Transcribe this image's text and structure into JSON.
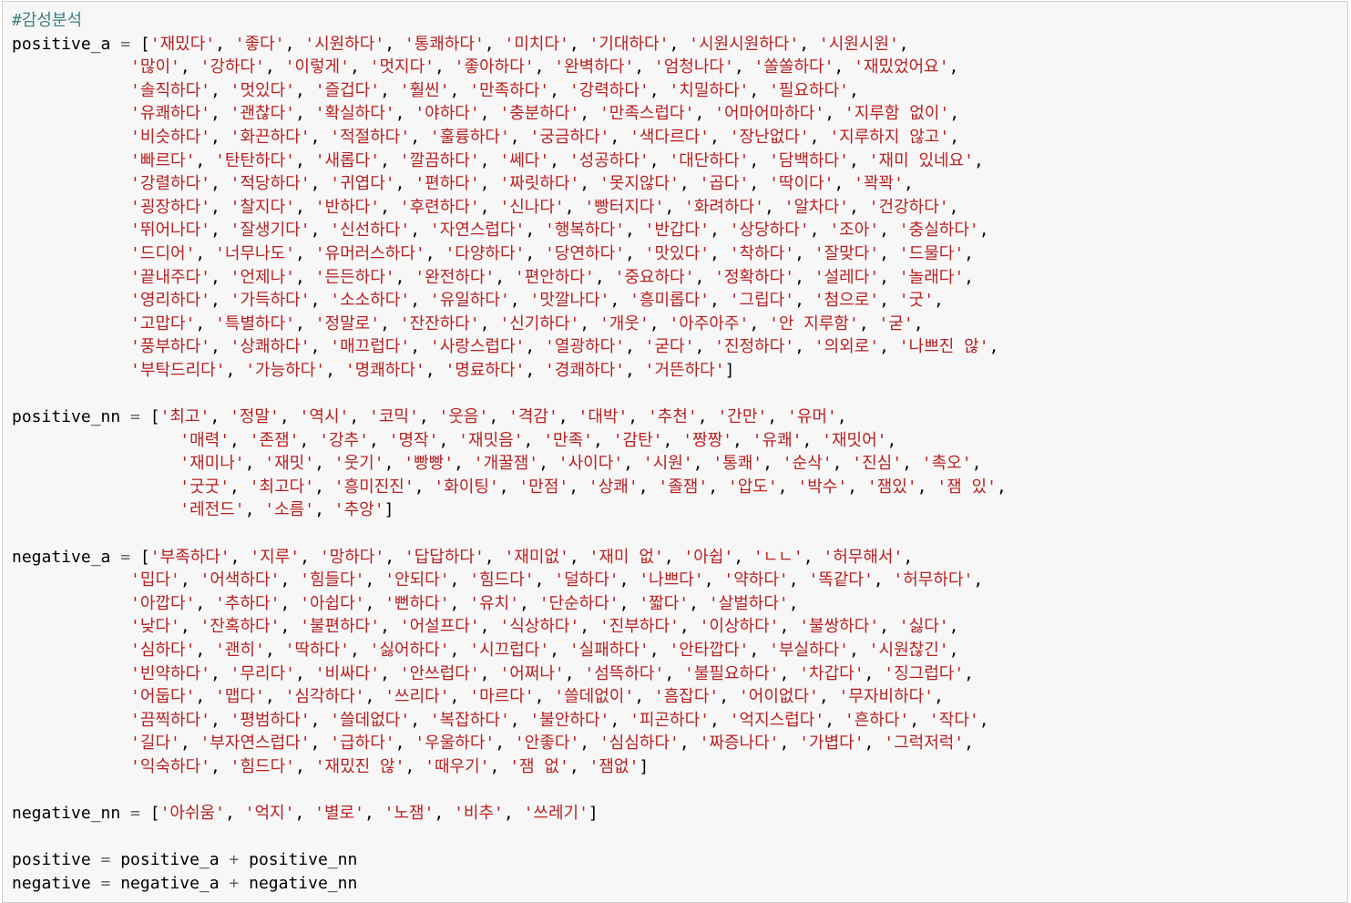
{
  "comment": "#감성분석",
  "blocks": [
    {
      "name": "positive_a",
      "indent": 12,
      "rows": [
        [
          "재밌다",
          "좋다",
          "시원하다",
          "통쾌하다",
          "미치다",
          "기대하다",
          "시원시원하다",
          "시원시원"
        ],
        [
          "많이",
          "강하다",
          "이렇게",
          "멋지다",
          "좋아하다",
          "완벽하다",
          "엄청나다",
          "쏠쏠하다",
          "재밌었어요"
        ],
        [
          "솔직하다",
          "멋있다",
          "즐겁다",
          "훨씬",
          "만족하다",
          "강력하다",
          "치밀하다",
          "필요하다"
        ],
        [
          "유쾌하다",
          "괜찮다",
          "확실하다",
          "야하다",
          "충분하다",
          "만족스럽다",
          "어마어마하다",
          "지루함 없이"
        ],
        [
          "비슷하다",
          "화끈하다",
          "적절하다",
          "훌륭하다",
          "궁금하다",
          "색다르다",
          "장난없다",
          "지루하지 않고"
        ],
        [
          "빠르다",
          "탄탄하다",
          "새롭다",
          "깔끔하다",
          "쎄다",
          "성공하다",
          "대단하다",
          "담백하다",
          "재미 있네요"
        ],
        [
          "강렬하다",
          "적당하다",
          "귀엽다",
          "편하다",
          "짜릿하다",
          "못지않다",
          "곱다",
          "딱이다",
          "꽉꽉"
        ],
        [
          "굉장하다",
          "찰지다",
          "반하다",
          "후련하다",
          "신나다",
          "빵터지다",
          "화려하다",
          "알차다",
          "건강하다"
        ],
        [
          "뛰어나다",
          "잘생기다",
          "신선하다",
          "자연스럽다",
          "행복하다",
          "반갑다",
          "상당하다",
          "조아",
          "충실하다"
        ],
        [
          "드디어",
          "너무나도",
          "유머러스하다",
          "다양하다",
          "당연하다",
          "맛있다",
          "착하다",
          "잘맞다",
          "드물다"
        ],
        [
          "끝내주다",
          "언제나",
          "든든하다",
          "완전하다",
          "편안하다",
          "중요하다",
          "정확하다",
          "설레다",
          "놀래다"
        ],
        [
          "영리하다",
          "가득하다",
          "소소하다",
          "유일하다",
          "맛깔나다",
          "흥미롭다",
          "그립다",
          "첨으로",
          "굿"
        ],
        [
          "고맙다",
          "특별하다",
          "정말로",
          "잔잔하다",
          "신기하다",
          "개웃",
          "아주아주",
          "안 지루함",
          "굳"
        ],
        [
          "풍부하다",
          "상쾌하다",
          "매끄럽다",
          "사랑스럽다",
          "열광하다",
          "굳다",
          "진정하다",
          "의외로",
          "나쁘진 않"
        ],
        [
          "부탁드리다",
          "가능하다",
          "명쾌하다",
          "명료하다",
          "경쾌하다",
          "거뜬하다"
        ]
      ]
    },
    {
      "name": "positive_nn",
      "indent": 17,
      "rows": [
        [
          "최고",
          "정말",
          "역시",
          "코믹",
          "웃음",
          "격감",
          "대박",
          "추천",
          "간만",
          "유머"
        ],
        [
          "매력",
          "존잼",
          "강추",
          "명작",
          "재밋음",
          "만족",
          "감탄",
          "짱짱",
          "유쾌",
          "재밋어"
        ],
        [
          "재미나",
          "재밋",
          "웃기",
          "빵빵",
          "개꿀잼",
          "사이다",
          "시원",
          "통쾌",
          "순삭",
          "진심",
          "촉오"
        ],
        [
          "굿굿",
          "최고다",
          "흥미진진",
          "화이팅",
          "만점",
          "상쾌",
          "졸잼",
          "압도",
          "박수",
          "잼있",
          "잼 있"
        ],
        [
          "레전드",
          "소름",
          "추앙"
        ]
      ]
    },
    {
      "name": "negative_a",
      "indent": 12,
      "rows": [
        [
          "부족하다",
          "지루",
          "망하다",
          "답답하다",
          "재미없",
          "재미 없",
          "아쉽",
          "ㄴㄴ",
          "허무해서"
        ],
        [
          "밉다",
          "어색하다",
          "힘들다",
          "안되다",
          "힘드다",
          "덜하다",
          "나쁘다",
          "약하다",
          "똑같다",
          "허무하다"
        ],
        [
          "아깝다",
          "추하다",
          "아쉽다",
          "뻔하다",
          "유치",
          "단순하다",
          "짧다",
          "살벌하다"
        ],
        [
          "낮다",
          "잔혹하다",
          "불편하다",
          "어설프다",
          "식상하다",
          "진부하다",
          "이상하다",
          "불쌍하다",
          "싫다"
        ],
        [
          "심하다",
          "괜히",
          "딱하다",
          "싫어하다",
          "시끄럽다",
          "실패하다",
          "안타깝다",
          "부실하다",
          "시원찮긴"
        ],
        [
          "빈약하다",
          "무리다",
          "비싸다",
          "안쓰럽다",
          "어쩌나",
          "섬뜩하다",
          "불필요하다",
          "차갑다",
          "징그럽다"
        ],
        [
          "어둡다",
          "맵다",
          "심각하다",
          "쓰리다",
          "마르다",
          "쓸데없이",
          "흠잡다",
          "어이없다",
          "무자비하다"
        ],
        [
          "끔찍하다",
          "평범하다",
          "쓸데없다",
          "복잡하다",
          "불안하다",
          "피곤하다",
          "억지스럽다",
          "흔하다",
          "작다"
        ],
        [
          "길다",
          "부자연스럽다",
          "급하다",
          "우울하다",
          "안좋다",
          "심심하다",
          "짜증나다",
          "가볍다",
          "그럭저럭"
        ],
        [
          "익숙하다",
          "힘드다",
          "재밌진 않",
          "때우기",
          "잼 없",
          "잼없"
        ]
      ]
    },
    {
      "name": "negative_nn",
      "indent": 0,
      "rows": [
        [
          "아쉬움",
          "억지",
          "별로",
          "노잼",
          "비추",
          "쓰레기"
        ]
      ]
    }
  ],
  "sums": [
    {
      "target": "positive",
      "a": "positive_a",
      "b": "positive_nn"
    },
    {
      "target": "negative",
      "a": "negative_a",
      "b": "negative_nn"
    }
  ]
}
